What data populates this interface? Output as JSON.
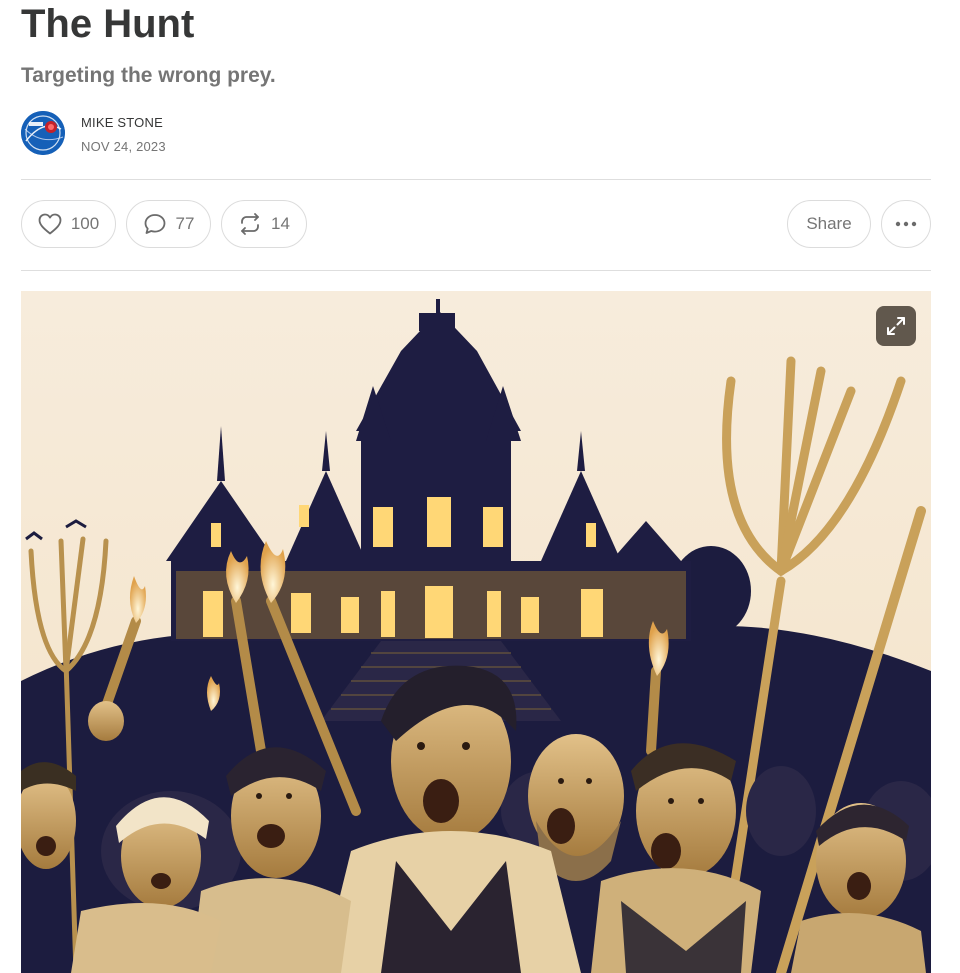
{
  "post": {
    "title": "The Hunt",
    "subtitle": "Targeting the wrong prey."
  },
  "byline": {
    "author": "MIKE STONE",
    "date": "NOV 24, 2023"
  },
  "actions": {
    "likes": "100",
    "comments": "77",
    "restacks": "14",
    "share_label": "Share"
  },
  "icons": {
    "like": "heart-icon",
    "comment": "comment-bubble-icon",
    "restack": "restack-arrows-icon",
    "more": "ellipsis-icon",
    "expand": "expand-icon"
  },
  "colors": {
    "text": "#363737",
    "muted": "#757575",
    "border": "#dcdcdc",
    "image_sky": "#f6ead8",
    "image_navy": "#1c1c3f",
    "image_gold": "#c9a15a"
  }
}
